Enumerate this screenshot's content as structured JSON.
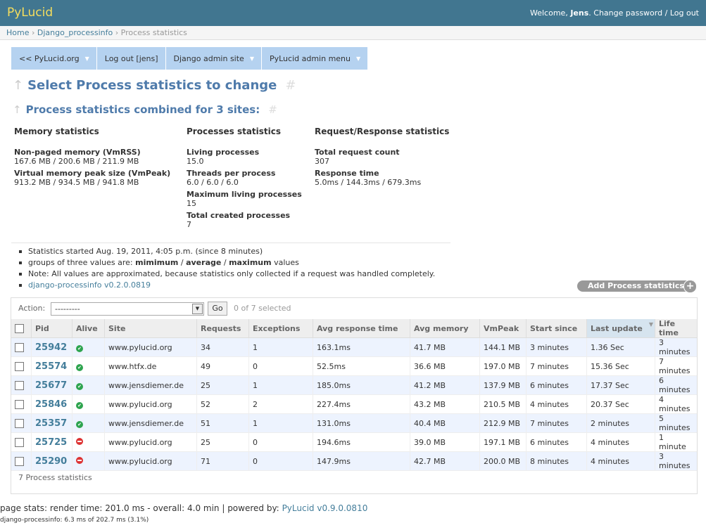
{
  "header": {
    "brand": "PyLucid",
    "welcome": "Welcome,",
    "user": "Jens",
    "change_password": "Change password",
    "separator": "/",
    "logout": "Log out"
  },
  "breadcrumbs": [
    "Home",
    "Django_processinfo",
    "Process statistics"
  ],
  "menu": [
    "<< PyLucid.org",
    "Log out [jens]",
    "Django admin site",
    "PyLucid admin menu"
  ],
  "headings": {
    "title": "Select Process statistics to change",
    "subtitle": "Process statistics combined for 3 sites:"
  },
  "stats": {
    "memory": {
      "header": "Memory statistics",
      "items": [
        {
          "label": "Non-paged memory (VmRSS)",
          "value": "167.6 MB / 200.6 MB / 211.9 MB"
        },
        {
          "label": "Virtual memory peak size (VmPeak)",
          "value": "913.2 MB / 934.5 MB / 941.8 MB"
        }
      ]
    },
    "processes": {
      "header": "Processes statistics",
      "items": [
        {
          "label": "Living processes",
          "value": "15.0"
        },
        {
          "label": "Threads per process",
          "value": "6.0 / 6.0 / 6.0"
        },
        {
          "label": "Maximum living processes",
          "value": "15"
        },
        {
          "label": "Total created processes",
          "value": "7"
        }
      ]
    },
    "requests": {
      "header": "Request/Response statistics",
      "items": [
        {
          "label": "Total request count",
          "value": "307"
        },
        {
          "label": "Response time",
          "value": "5.0ms / 144.3ms / 679.3ms"
        }
      ]
    }
  },
  "notes": {
    "started": "Statistics started Aug. 19, 2011, 4:05 p.m. (since 8 minutes)",
    "groups_prefix": "groups of three values are:",
    "groups_min": "mimimum",
    "groups_avg": "average",
    "groups_max": "maximum",
    "groups_suffix": "values",
    "slash": "/",
    "approx": "Note: All values are approximated, because statistics only collected if a request was handled completely.",
    "version_link": "django-processinfo v0.2.0.0819"
  },
  "add_button": "Add Process statistics",
  "actions": {
    "label": "Action:",
    "selected": "---------",
    "go": "Go",
    "counter": "0 of 7 selected"
  },
  "table": {
    "columns": [
      "Pid",
      "Alive",
      "Site",
      "Requests",
      "Exceptions",
      "Avg response time",
      "Avg memory",
      "VmPeak",
      "Start since",
      "Last update",
      "Life time"
    ],
    "rows": [
      {
        "pid": "25942",
        "alive": true,
        "site": "www.pylucid.org",
        "requests": "34",
        "exceptions": "1",
        "avg_response": "163.1ms",
        "avg_memory": "41.7 MB",
        "vmpeak": "144.1 MB",
        "start_since": "3 minutes",
        "last_update": "1.36 Sec",
        "life_time": "3 minutes"
      },
      {
        "pid": "25574",
        "alive": true,
        "site": "www.htfx.de",
        "requests": "49",
        "exceptions": "0",
        "avg_response": "52.5ms",
        "avg_memory": "36.6 MB",
        "vmpeak": "197.0 MB",
        "start_since": "7 minutes",
        "last_update": "15.36 Sec",
        "life_time": "7 minutes"
      },
      {
        "pid": "25677",
        "alive": true,
        "site": "www.jensdiemer.de",
        "requests": "25",
        "exceptions": "1",
        "avg_response": "185.0ms",
        "avg_memory": "41.2 MB",
        "vmpeak": "137.9 MB",
        "start_since": "6 minutes",
        "last_update": "17.37 Sec",
        "life_time": "6 minutes"
      },
      {
        "pid": "25846",
        "alive": true,
        "site": "www.pylucid.org",
        "requests": "52",
        "exceptions": "2",
        "avg_response": "227.4ms",
        "avg_memory": "43.2 MB",
        "vmpeak": "210.5 MB",
        "start_since": "4 minutes",
        "last_update": "20.37 Sec",
        "life_time": "4 minutes"
      },
      {
        "pid": "25357",
        "alive": true,
        "site": "www.jensdiemer.de",
        "requests": "51",
        "exceptions": "1",
        "avg_response": "131.0ms",
        "avg_memory": "40.4 MB",
        "vmpeak": "212.9 MB",
        "start_since": "7 minutes",
        "last_update": "2 minutes",
        "life_time": "5 minutes"
      },
      {
        "pid": "25725",
        "alive": false,
        "site": "www.pylucid.org",
        "requests": "25",
        "exceptions": "0",
        "avg_response": "194.6ms",
        "avg_memory": "39.0 MB",
        "vmpeak": "197.1 MB",
        "start_since": "6 minutes",
        "last_update": "4 minutes",
        "life_time": "1 minute"
      },
      {
        "pid": "25290",
        "alive": false,
        "site": "www.pylucid.org",
        "requests": "71",
        "exceptions": "0",
        "avg_response": "147.9ms",
        "avg_memory": "42.7 MB",
        "vmpeak": "200.0 MB",
        "start_since": "8 minutes",
        "last_update": "4 minutes",
        "life_time": "3 minutes"
      }
    ]
  },
  "paginator": "7 Process statistics",
  "footer": {
    "stats": "page stats: render time: 201.0 ms - overall: 4.0 min | powered by:",
    "powered_link": "PyLucid v0.9.0.0810",
    "processinfo": "django-processinfo: 6.3 ms of 202.7 ms (3.1%)"
  }
}
